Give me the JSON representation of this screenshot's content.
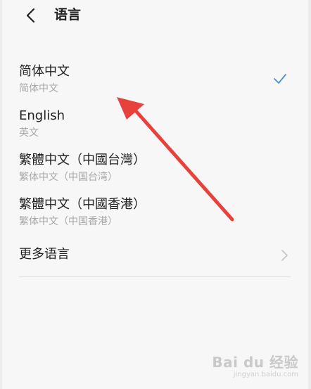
{
  "header": {
    "title": "语言",
    "back_icon": "chevron-left-icon"
  },
  "languages": [
    {
      "primary": "简体中文",
      "secondary": "简体中文",
      "selected": true
    },
    {
      "primary": "English",
      "secondary": "英文",
      "selected": false
    },
    {
      "primary": "繁體中文（中國台灣）",
      "secondary": "繁体中文（中国台湾）",
      "selected": false
    },
    {
      "primary": "繁體中文（中國香港）",
      "secondary": "繁体中文（中国香港）",
      "selected": false
    }
  ],
  "more": {
    "label": "更多语言",
    "icon": "chevron-right-icon"
  },
  "colors": {
    "accent": "#4a90d9",
    "annotation_arrow": "#e8413c",
    "text_primary": "#222222",
    "text_secondary": "#a8a8a8"
  },
  "watermark": {
    "main": "Bai du 经验",
    "sub": "jingyan.baidu.com"
  }
}
